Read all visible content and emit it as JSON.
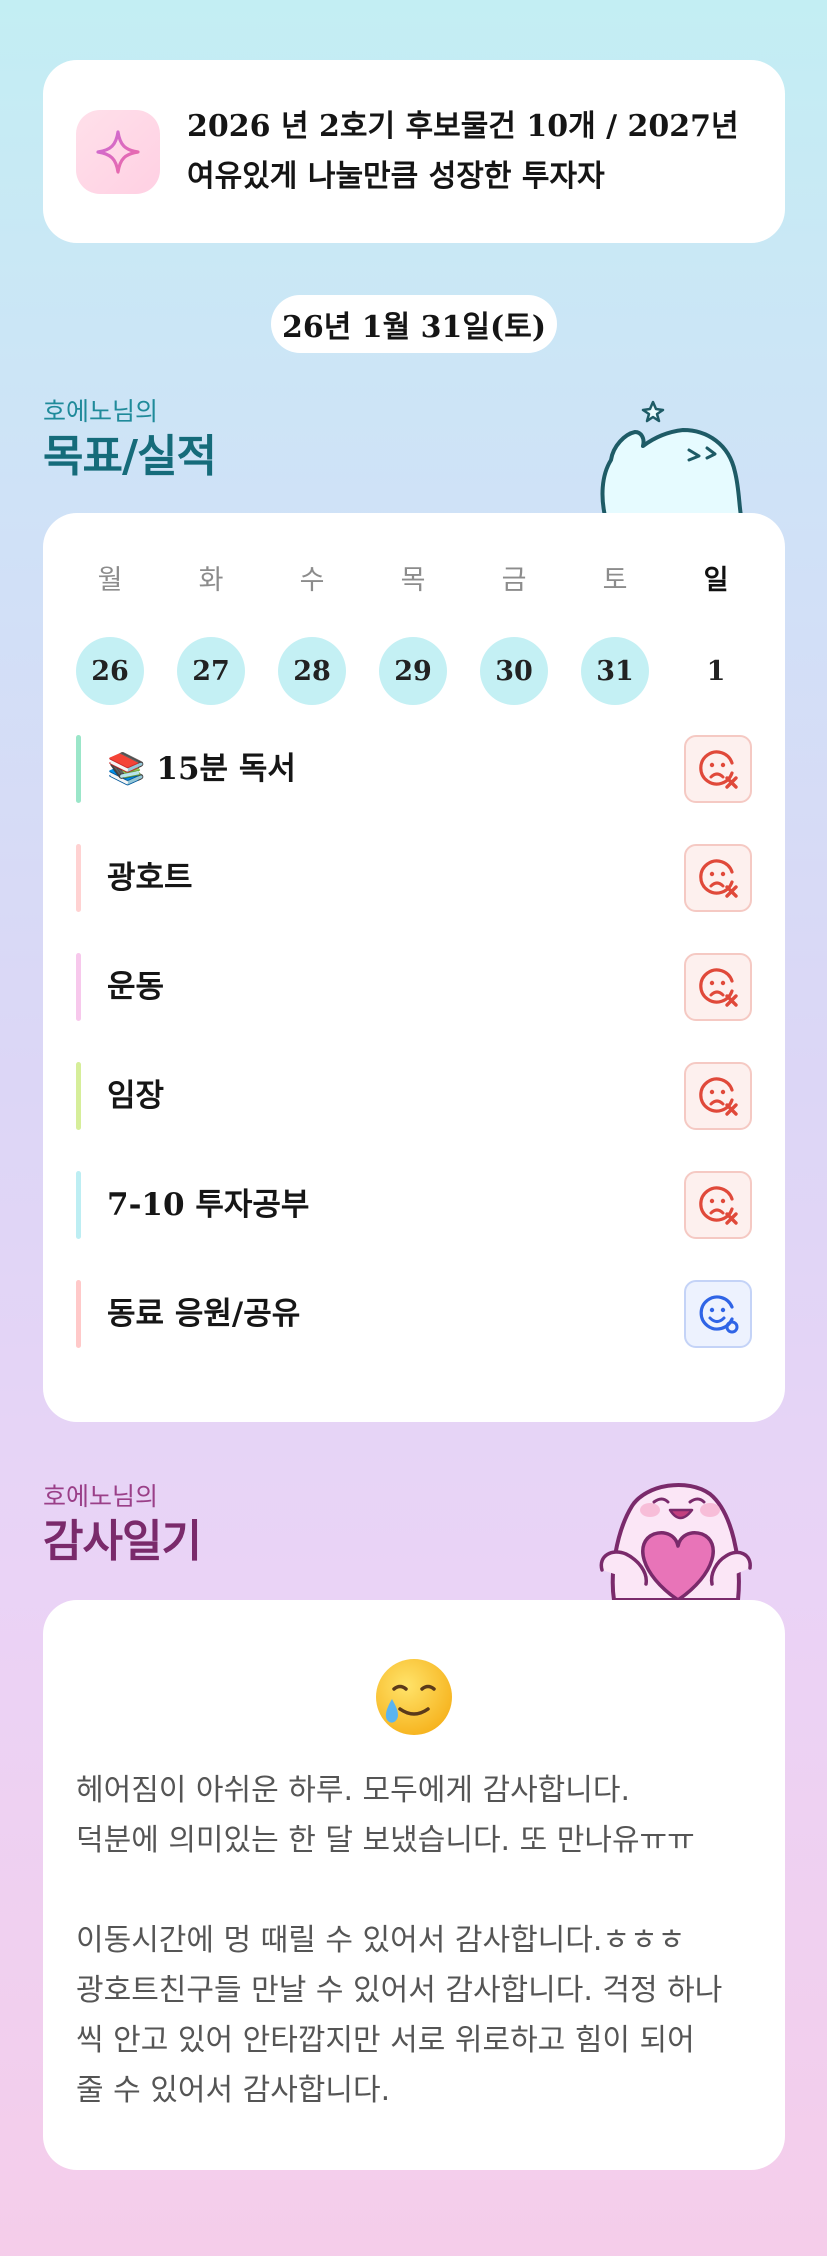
{
  "goal": {
    "text": "2026 년 2호기 후보물건 10개 / 2027년 여유있게 나눌만큼 성장한 투자자",
    "icon": "sparkle-icon"
  },
  "date_label": "26년 1월 31일(토)",
  "goal_section": {
    "subtitle": "호에노님의",
    "title": "목표/실적"
  },
  "week": {
    "days": [
      {
        "name": "월",
        "num": "26",
        "done": true
      },
      {
        "name": "화",
        "num": "27",
        "done": true
      },
      {
        "name": "수",
        "num": "28",
        "done": true
      },
      {
        "name": "목",
        "num": "29",
        "done": true
      },
      {
        "name": "금",
        "num": "30",
        "done": true
      },
      {
        "name": "토",
        "num": "31",
        "done": true
      },
      {
        "name": "일",
        "num": "1",
        "done": false
      }
    ]
  },
  "habits": [
    {
      "label": "📚 15분 독서",
      "status": "fail",
      "color": "#9be6c9"
    },
    {
      "label": "광호트",
      "status": "fail",
      "color": "#ffd2d2"
    },
    {
      "label": "운동",
      "status": "fail",
      "color": "#f7c8ec"
    },
    {
      "label": "임장",
      "status": "fail",
      "color": "#d6ee9a"
    },
    {
      "label": "7-10 투자공부",
      "status": "fail",
      "color": "#bdeef3"
    },
    {
      "label": "동료 응원/공유",
      "status": "ok",
      "color": "#ffc9c9"
    }
  ],
  "diary_section": {
    "subtitle": "호에노님의",
    "title": "감사일기"
  },
  "diary": {
    "emoji": "teary-smile-emoji",
    "lines": [
      "헤어짐이 아쉬운 하루. 모두에게 감사합니다.",
      "덕분에 의미있는 한 달 보냈습니다. 또 만나유ㅠㅠ",
      "",
      "이동시간에 멍 때릴 수 있어서 감사합니다.ㅎㅎㅎ",
      "광호트친구들 만날 수 있어서 감사합니다. 걱정 하나",
      "씩 안고 있어 안타깝지만 서로 위로하고 힘이 되어",
      "줄 수 있어서 감사합니다."
    ]
  },
  "colors": {
    "goal_title": "#156b7a",
    "diary_title": "#7a2a6b",
    "done_circle": "#c4f0f4",
    "fail_icon": "#e0493a",
    "ok_icon": "#2f64e6"
  }
}
